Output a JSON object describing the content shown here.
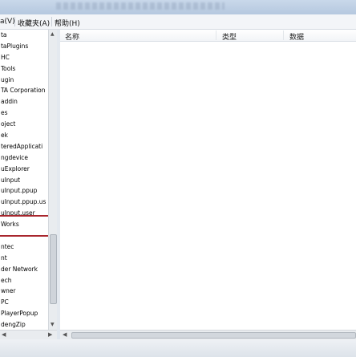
{
  "menubar": {
    "items": [
      {
        "label": "a(V)"
      },
      {
        "label": "收藏夹(A)"
      },
      {
        "label": "帮助(H)"
      }
    ]
  },
  "tree": {
    "items": [
      "ta",
      "taPlugins",
      "HC",
      "Tools",
      "ugin",
      "TA Corporation",
      "addin",
      "es",
      "oject",
      "ek",
      "teredApplicati",
      "ngdevice",
      "uExplorer",
      "uInput",
      "uInput.ppup",
      "uInput.ppup.us",
      "uInput.user",
      "Works",
      "",
      "ntec",
      "nt",
      "der Network",
      "ech",
      "wner",
      "PC",
      "PlayerPopup",
      "dengZip"
    ]
  },
  "list": {
    "columns": {
      "name": "名称",
      "type": "类型",
      "data": "数据"
    }
  }
}
